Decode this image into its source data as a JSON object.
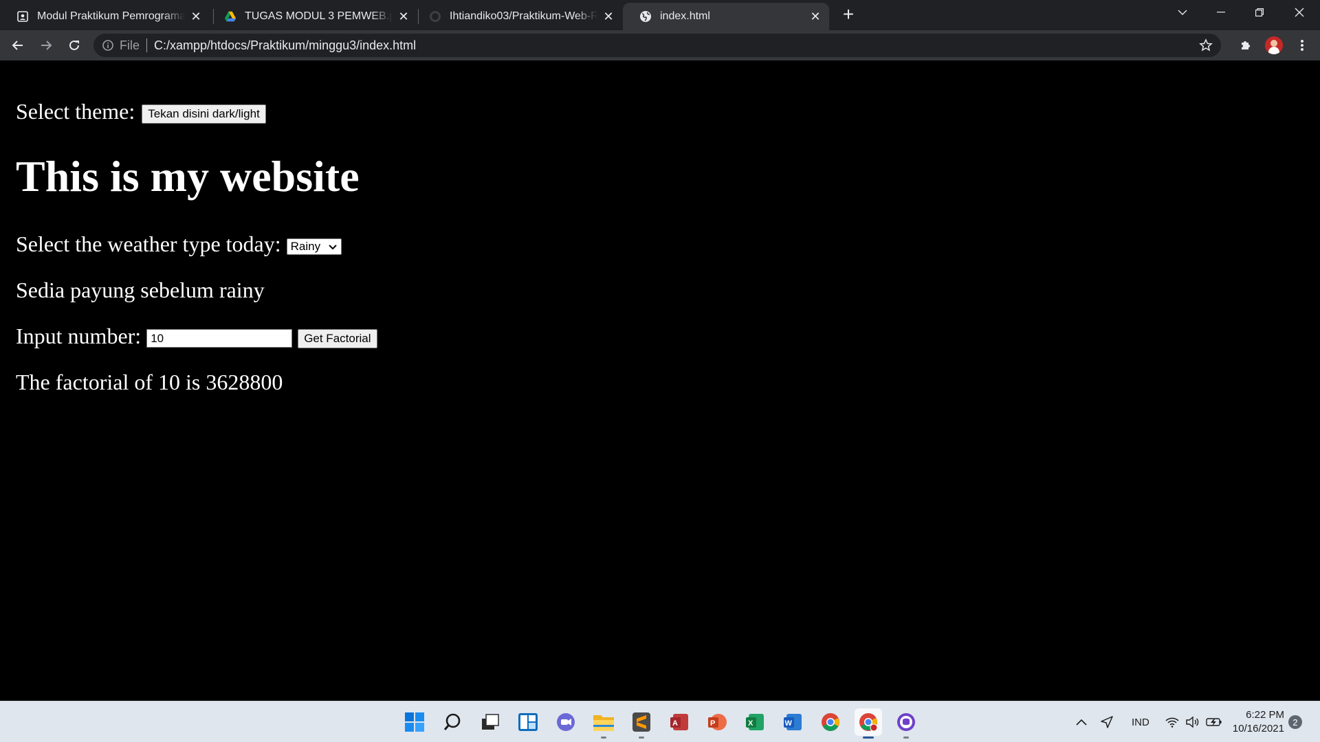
{
  "browser": {
    "tabs": [
      {
        "title": "Modul Praktikum Pemrograman Web",
        "icon": "document-icon"
      },
      {
        "title": "TUGAS MODUL 3 PEMWEB.pdf - Google Drive",
        "icon": "google-drive-icon"
      },
      {
        "title": "Ihtiandiko03/Praktikum-Web-RC",
        "icon": "github-icon"
      },
      {
        "title": "index.html",
        "icon": "globe-icon"
      }
    ],
    "omnibox": {
      "scheme_label": "File",
      "url": "C:/xampp/htdocs/Praktikum/minggu3/index.html"
    }
  },
  "page": {
    "theme_label": "Select theme:",
    "theme_button": "Tekan disini dark/light",
    "heading": "This is my website",
    "weather_label": "Select the weather type today:",
    "weather_selected": "Rainy",
    "weather_message": "Sedia payung sebelum rainy",
    "number_label": "Input number:",
    "number_value": "10",
    "factorial_button": "Get Factorial",
    "factorial_result": "The factorial of 10 is 3628800"
  },
  "taskbar": {
    "apps": [
      "start-icon",
      "search-icon",
      "task-view-icon",
      "widgets-icon",
      "teams-chat-icon",
      "file-explorer-icon",
      "sublime-text-icon",
      "access-icon",
      "powerpoint-icon",
      "excel-icon",
      "word-icon",
      "chrome-icon",
      "chrome-profile-icon",
      "github-desktop-icon"
    ],
    "language": "IND",
    "time": "6:22 PM",
    "date": "10/16/2021",
    "notification_count": "2"
  },
  "colors": {
    "page_background": "#000000",
    "page_text": "#ffffff",
    "chrome_dark": "#202124",
    "chrome_toolbar": "#35363a",
    "taskbar": "#dfe6ee"
  }
}
